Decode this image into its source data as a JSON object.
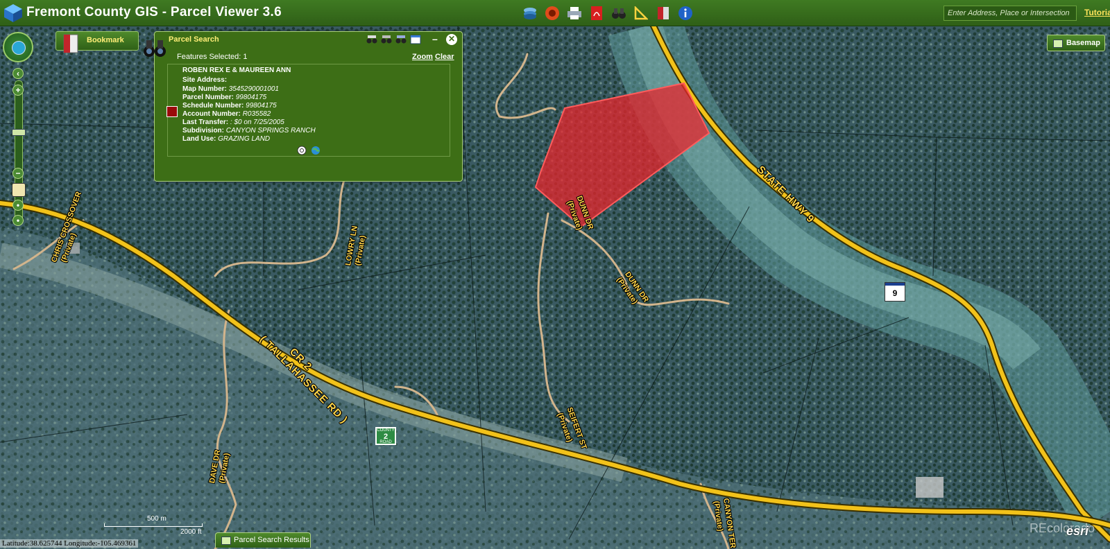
{
  "app": {
    "title": "Fremont County GIS - Parcel Viewer 3.6",
    "search_placeholder": "Enter Address, Place or Intersection",
    "tutorial_label": "Tutorial",
    "tool_icons": [
      "layers-icon",
      "record-icon",
      "print-icon",
      "pdf-icon",
      "binoculars-icon",
      "measure-icon",
      "bookmark-icon",
      "info-icon"
    ]
  },
  "bookmark": {
    "label": "Bookmark"
  },
  "basemap": {
    "label": "Basemap"
  },
  "parcel_search": {
    "title": "Parcel Search",
    "features_selected": "Features Selected: 1",
    "zoom_label": "Zoom",
    "clear_label": "Clear",
    "result": {
      "owner": "ROBEN  REX E & MAUREEN ANN",
      "swatch_color": "#9a0a0a",
      "fields": [
        {
          "label": "Site Address:",
          "value": ""
        },
        {
          "label": "Map Number:",
          "value": "3545290001001"
        },
        {
          "label": "Parcel Number:",
          "value": "99804175"
        },
        {
          "label": "Schedule Number:",
          "value": "99804175"
        },
        {
          "label": "Account Number:",
          "value": "R035582"
        },
        {
          "label": "Last Transfer:",
          "value": ": $0 on 7/25/2005"
        },
        {
          "label": "Subdivision:",
          "value": "CANYON SPRINGS RANCH"
        },
        {
          "label": "Land Use:",
          "value": "GRAZING LAND"
        }
      ]
    }
  },
  "map": {
    "road_labels": {
      "state_hwy": "STATE HWY 9",
      "cr2": "CR 2",
      "tallahassee": "( TALLAHASSEE RD )",
      "chris_crossover": "CHRIS CROSSOVER",
      "chris_private": "(Private)",
      "lowry": "LOWRY LN",
      "lowry_private": "(Private)",
      "dunn_dr_top": "DUNN DR",
      "dunn_top_private": "(Private)",
      "dunn_dr": "DUNN DR",
      "dunn_private": "(Private)",
      "seifert": "SEIFERT ST",
      "seifert_private": "(Private)",
      "dave_dr": "DAVE DR",
      "dave_private": "(Private)",
      "canyon": "CANYON TER",
      "canyon_private": "(Private)"
    },
    "county_sign": {
      "top": "COUNTY",
      "number": "2",
      "bottom": "ROAD"
    },
    "state_sign": "9",
    "scale_m": "500 m",
    "scale_ft": "2000 ft",
    "coords": "Latitude:38.625744   Longitude:-105.469361",
    "watermark": "REcolorado",
    "esri": "esri",
    "parcel_color": "#e8262c",
    "road_color": "#f2c21a"
  },
  "results_tab": {
    "label": "Parcel Search Results"
  }
}
